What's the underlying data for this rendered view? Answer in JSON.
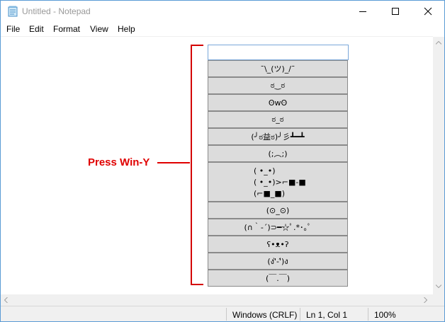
{
  "window": {
    "title": "Untitled - Notepad",
    "icon": "notepad-icon"
  },
  "menu": {
    "items": [
      "File",
      "Edit",
      "Format",
      "View",
      "Help"
    ]
  },
  "editor": {
    "text": ""
  },
  "emoji_panel": {
    "search_value": "",
    "kaomoji": [
      "¯\\_(ツ)_/¯",
      "ಠ‿ಠ",
      "ʘwʘ",
      "ಠ_ಠ",
      "(╯ಠ益ಠ)╯彡┻━┻",
      "(;︵;)",
      [
        "( •_•)",
        "( •_•)>⌐■-■",
        "(⌐■_■)"
      ],
      "(⊙_⊙)",
      "(∩｀-´)⊃━☆ﾟ.*･｡ﾟ",
      "ʕ•ᴥ•ʔ",
      "(ง'̀-'́)ง",
      "(￣.￣)"
    ]
  },
  "annotation": {
    "label": "Press Win-Y",
    "color": "#e00000"
  },
  "status": {
    "encoding": "Windows (CRLF)",
    "position": "Ln 1, Col 1",
    "zoom": "100%"
  }
}
